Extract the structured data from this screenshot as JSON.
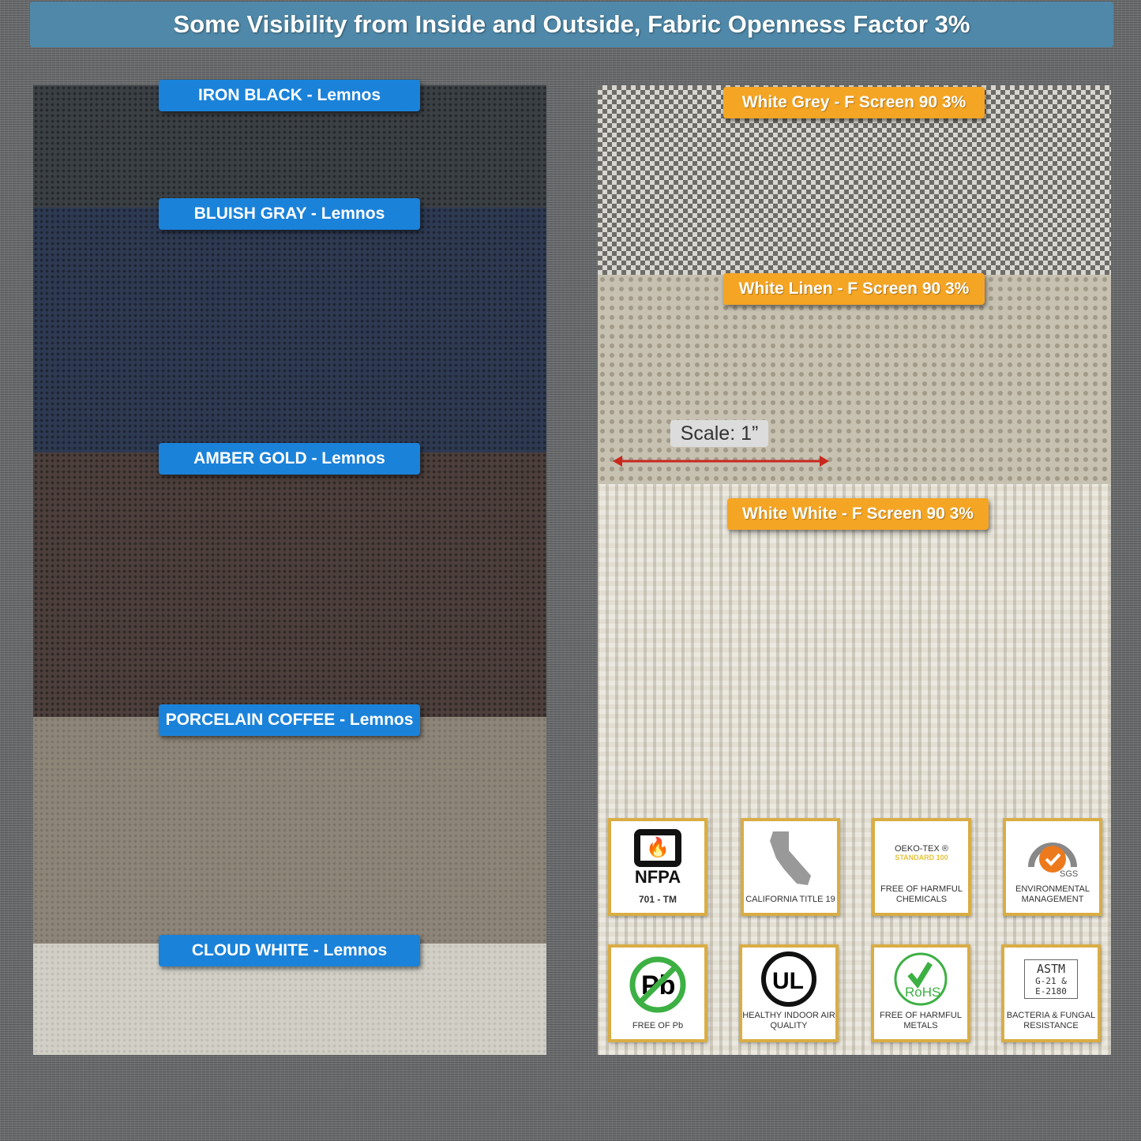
{
  "banner": "Some Visibility from Inside and Outside, Fabric Openness Factor 3%",
  "left_swatches": [
    {
      "label": "IRON BLACK - Lemnos",
      "color": "#3b4045"
    },
    {
      "label": "BLUISH GRAY - Lemnos",
      "color": "#2e3a52"
    },
    {
      "label": "AMBER GOLD - Lemnos",
      "color": "#4c3f3c"
    },
    {
      "label": "PORCELAIN COFFEE - Lemnos",
      "color": "#8e8579"
    },
    {
      "label": "CLOUD WHITE - Lemnos",
      "color": "#d1cfc6"
    }
  ],
  "right_swatches": [
    {
      "label": "White Grey - F Screen 90  3%",
      "color": "#9a9894"
    },
    {
      "label": "White Linen - F Screen 90 3%",
      "color": "#c7c1b1"
    },
    {
      "label": "White White - F Screen 90 3%",
      "color": "#e2ded2"
    }
  ],
  "scale": "Scale: 1”",
  "badges": [
    {
      "icon": "nfpa-flame-icon",
      "logo": "NFPA",
      "caption": "701 - TM"
    },
    {
      "icon": "california-map-icon",
      "caption": "CALIFORNIA TITLE 19"
    },
    {
      "icon": "oeko-tex-icon",
      "logo": "OEKO-TEX ®",
      "logo_sub": "STANDARD 100",
      "caption": "FREE OF HARMFUL CHEMICALS"
    },
    {
      "icon": "sgs-check-icon",
      "logo": "SGS",
      "caption": "ENVIRONMENTAL MANAGEMENT"
    },
    {
      "icon": "no-lead-icon",
      "logo": "Pb",
      "caption": "FREE OF Pb"
    },
    {
      "icon": "ul-icon",
      "logo": "UL",
      "caption": "HEALTHY INDOOR AIR QUALITY"
    },
    {
      "icon": "rohs-icon",
      "logo": "RoHS",
      "caption": "FREE OF HARMFUL METALS"
    },
    {
      "icon": "astm-icon",
      "logo": "ASTM",
      "logo_sub": "G-21 & E-2180",
      "caption": "BACTERIA & FUNGAL RESISTANCE"
    }
  ],
  "colors": {
    "label_blue": "#1b82d9",
    "label_orange": "#f5a524",
    "badge_border": "#d9ad45",
    "arrow": "#c8281e"
  }
}
